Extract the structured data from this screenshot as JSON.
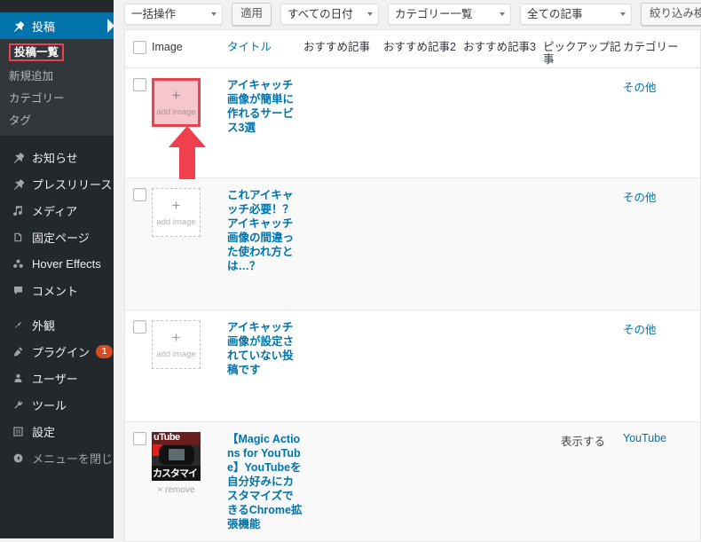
{
  "sidebar": {
    "items": [
      {
        "label": "投稿",
        "icon": "pin-icon",
        "current": true,
        "submenu": [
          {
            "label": "投稿一覧",
            "current": true
          },
          {
            "label": "新規追加",
            "current": false
          },
          {
            "label": "カテゴリー",
            "current": false
          },
          {
            "label": "タグ",
            "current": false
          }
        ]
      },
      {
        "label": "お知らせ",
        "icon": "pin-icon",
        "current": false
      },
      {
        "label": "プレスリリース",
        "icon": "pin-icon",
        "current": false
      },
      {
        "label": "メディア",
        "icon": "media-icon",
        "current": false
      },
      {
        "label": "固定ページ",
        "icon": "page-icon",
        "current": false
      },
      {
        "label": "Hover Effects",
        "icon": "plugin-group-icon",
        "current": false
      },
      {
        "label": "コメント",
        "icon": "comment-icon",
        "current": false
      },
      {
        "label": "外観",
        "icon": "brush-icon",
        "current": false
      },
      {
        "label": "プラグイン",
        "icon": "plug-icon",
        "current": false,
        "badge": "1"
      },
      {
        "label": "ユーザー",
        "icon": "user-icon",
        "current": false
      },
      {
        "label": "ツール",
        "icon": "wrench-icon",
        "current": false
      },
      {
        "label": "設定",
        "icon": "settings-icon",
        "current": false
      },
      {
        "label": "メニューを閉じる",
        "icon": "collapse-icon",
        "current": false
      }
    ]
  },
  "toolbar": {
    "bulk_action": "一括操作",
    "apply": "適用",
    "date_filter": "すべての日付",
    "category_filter": "カテゴリー一覧",
    "post_filter": "全ての記事",
    "filter_button": "絞り込み検索"
  },
  "table": {
    "columns": [
      {
        "key": "cb",
        "label": ""
      },
      {
        "key": "image",
        "label": "Image"
      },
      {
        "key": "title",
        "label": "タイトル"
      },
      {
        "key": "rec1",
        "label": "おすすめ記事"
      },
      {
        "key": "rec2",
        "label": "おすすめ記事2"
      },
      {
        "key": "rec3",
        "label": "おすすめ記事3"
      },
      {
        "key": "pickup",
        "label": "ピックアップ記事"
      },
      {
        "key": "category",
        "label": "カテゴリー"
      }
    ],
    "placeholder": {
      "plus": "+",
      "caption": "add image"
    },
    "remove_label": "× remove",
    "rows": [
      {
        "image_state": "placeholder",
        "highlighted": true,
        "title": "アイキャッチ画像が簡単に作れるサービス3選",
        "rec1": "",
        "rec2": "",
        "rec3": "",
        "pickup": "",
        "category": "その他"
      },
      {
        "image_state": "placeholder",
        "highlighted": false,
        "title": "これアイキャッチ必要！？アイキャッチ画像の間違った使われ方とは…？",
        "rec1": "",
        "rec2": "",
        "rec3": "",
        "pickup": "",
        "category": "その他"
      },
      {
        "image_state": "placeholder",
        "highlighted": false,
        "title": "アイキャッチ画像が設定されていない投稿です",
        "rec1": "",
        "rec2": "",
        "rec3": "",
        "pickup": "",
        "category": "その他"
      },
      {
        "image_state": "thumbnail",
        "highlighted": false,
        "thumbnail_text_top": "uTube",
        "thumbnail_text_bottom": "カスタマイ",
        "title": "【Magic Actions for YouTube】YouTubeを自分好みにカスタマイズできるChrome拡張機能",
        "rec1": "",
        "rec2": "",
        "rec3": "",
        "pickup": "表示する",
        "category": "YouTube"
      }
    ]
  },
  "annotation": {
    "arrow_color": "#f0404f",
    "highlight_border_color": "#e8434f",
    "highlight_fill_color": "#f5c7cc"
  }
}
